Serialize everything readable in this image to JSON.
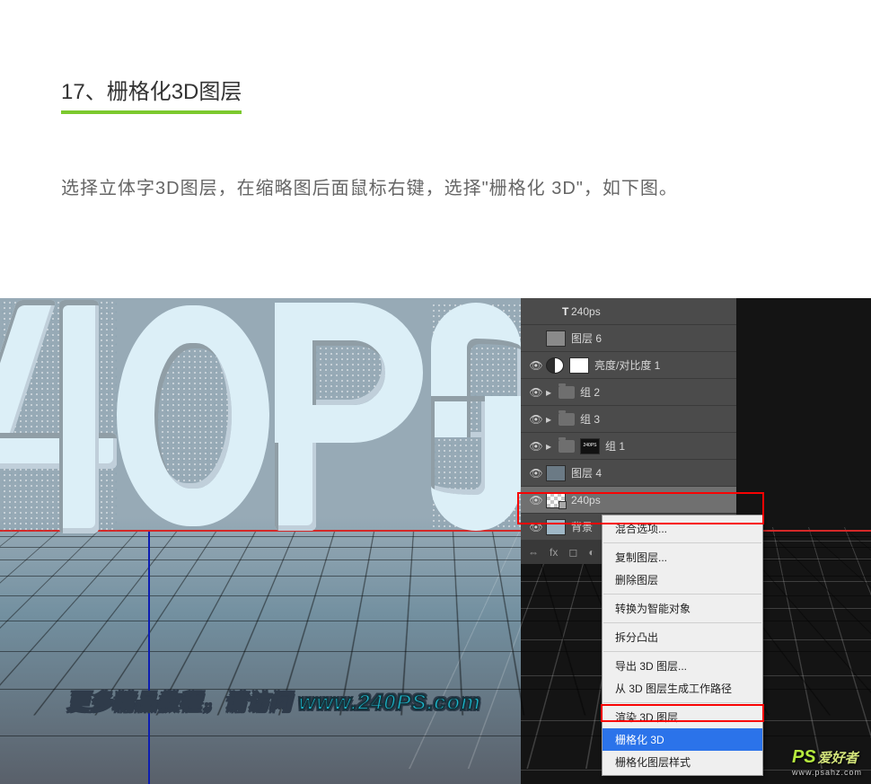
{
  "heading": "17、栅格化3D图层",
  "body": "选择立体字3D图层，在缩略图后面鼠标右键，选择\"栅格化 3D\"，如下图。",
  "promo_prefix": "更多精品教程，请访问",
  "promo_url": "www.240PS.com",
  "watermark_brand": "PS",
  "watermark_text": "爱好者",
  "watermark_sub": "www.psahz.com",
  "layers": {
    "row_text_240ps": "240ps",
    "row_layer6": "图层 6",
    "row_brightness": "亮度/对比度 1",
    "row_group2": "组 2",
    "row_group3": "组 3",
    "row_group1": "组 1",
    "row_layer4": "图层 4",
    "row_240ps3d": "240ps ",
    "row_bg": "背景"
  },
  "panel_footer": {
    "link": "⇔",
    "fx": "fx",
    "mask": "◻",
    "adj": "◐"
  },
  "menu": {
    "blending": "混合选项...",
    "duplicate": "复制图层...",
    "delete": "删除图层",
    "smart": "转换为智能对象",
    "split": "拆分凸出",
    "export3d": "导出 3D 图层...",
    "genpath": "从 3D 图层生成工作路径",
    "render": "渲染 3D 图层",
    "rasterize": "栅格化 3D",
    "rasterizeStyle": "栅格化图层样式"
  }
}
